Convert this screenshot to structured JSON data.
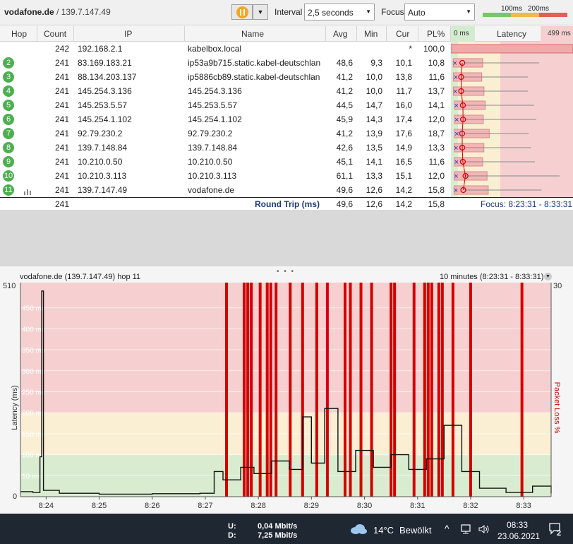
{
  "toolbar": {
    "host": "vodafone.de",
    "sep": " / ",
    "ip": "139.7.147.49",
    "interval_label": "Interval",
    "interval_value": "2,5 seconds",
    "focus_label": "Focus",
    "focus_value": "Auto",
    "scale_100": "100ms",
    "scale_200": "200ms"
  },
  "columns": {
    "hop": "Hop",
    "count": "Count",
    "ip": "IP",
    "name": "Name",
    "avg": "Avg",
    "min": "Min",
    "cur": "Cur",
    "pl": "PL%",
    "lat_min": "0 ms",
    "latency": "Latency",
    "lat_max": "499 ms"
  },
  "rows": [
    {
      "hop": "",
      "count": "242",
      "ip": "192.168.2.1",
      "name": "kabelbox.local",
      "avg": "",
      "min": "",
      "cur": "*",
      "pl": "100,0"
    },
    {
      "hop": "2",
      "count": "241",
      "ip": "83.169.183.21",
      "name": "ip53a9b715.static.kabel-deutschlan",
      "avg": "48,6",
      "min": "9,3",
      "cur": "10,1",
      "pl": "10,8"
    },
    {
      "hop": "3",
      "count": "241",
      "ip": "88.134.203.137",
      "name": "ip5886cb89.static.kabel-deutschlan",
      "avg": "41,2",
      "min": "10,0",
      "cur": "13,8",
      "pl": "11,6"
    },
    {
      "hop": "4",
      "count": "241",
      "ip": "145.254.3.136",
      "name": "145.254.3.136",
      "avg": "41,2",
      "min": "10,0",
      "cur": "11,7",
      "pl": "13,7"
    },
    {
      "hop": "5",
      "count": "241",
      "ip": "145.253.5.57",
      "name": "145.253.5.57",
      "avg": "44,5",
      "min": "14,7",
      "cur": "16,0",
      "pl": "14,1"
    },
    {
      "hop": "6",
      "count": "241",
      "ip": "145.254.1.102",
      "name": "145.254.1.102",
      "avg": "45,9",
      "min": "14,3",
      "cur": "17,4",
      "pl": "12,0"
    },
    {
      "hop": "7",
      "count": "241",
      "ip": "92.79.230.2",
      "name": "92.79.230.2",
      "avg": "41,2",
      "min": "13,9",
      "cur": "17,6",
      "pl": "18,7"
    },
    {
      "hop": "8",
      "count": "241",
      "ip": "139.7.148.84",
      "name": "139.7.148.84",
      "avg": "42,6",
      "min": "13,5",
      "cur": "14,9",
      "pl": "13,3"
    },
    {
      "hop": "9",
      "count": "241",
      "ip": "10.210.0.50",
      "name": "10.210.0.50",
      "avg": "45,1",
      "min": "14,1",
      "cur": "16,5",
      "pl": "11,6"
    },
    {
      "hop": "10",
      "count": "241",
      "ip": "10.210.3.113",
      "name": "10.210.3.113",
      "avg": "61,1",
      "min": "13,3",
      "cur": "15,1",
      "pl": "12,0"
    },
    {
      "hop": "11",
      "count": "241",
      "ip": "139.7.147.49",
      "name": "vodafone.de",
      "avg": "49,6",
      "min": "12,6",
      "cur": "14,2",
      "pl": "15,8"
    }
  ],
  "footer": {
    "count": "241",
    "label": "Round Trip (ms)",
    "avg": "49,6",
    "min": "12,6",
    "cur": "14,2",
    "pl": "15,8",
    "focus": "Focus: 8:23:31 - 8:33:31"
  },
  "graph": {
    "title": "vodafone.de (139.7.147.49) hop 11",
    "range": "10 minutes (8:23:31 - 8:33:31)",
    "y_max": "510",
    "y_zero": "0",
    "right_max": "30",
    "y_axis_label": "Latency (ms)",
    "right_axis_label": "Packet Loss %",
    "y_ticks": [
      "450 ms",
      "400 ms",
      "350 ms",
      "300 ms",
      "250 ms",
      "200 ms",
      "150 ms",
      "100 ms",
      "50 ms"
    ],
    "x_ticks": [
      "8:24",
      "8:25",
      "8:26",
      "8:27",
      "8:28",
      "8:29",
      "8:30",
      "8:31",
      "8:32",
      "8:33"
    ]
  },
  "chart_data": {
    "type": "line",
    "title": "vodafone.de (139.7.147.49) hop 11",
    "xlabel": "",
    "ylabel": "Latency (ms)",
    "y2label": "Packet Loss %",
    "ylim": [
      0,
      510
    ],
    "y2lim": [
      0,
      30
    ],
    "xlim": [
      "8:23:31",
      "8:33:31"
    ],
    "x_ticks": [
      "8:24",
      "8:25",
      "8:26",
      "8:27",
      "8:28",
      "8:29",
      "8:30",
      "8:31",
      "8:32",
      "8:33"
    ],
    "latency_series": [
      [
        "8:23:31",
        12
      ],
      [
        "8:23:45",
        10
      ],
      [
        "8:23:53",
        95
      ],
      [
        "8:23:55",
        490
      ],
      [
        "8:23:57",
        15
      ],
      [
        "8:24:15",
        8
      ],
      [
        "8:25:00",
        6
      ],
      [
        "8:26:00",
        7
      ],
      [
        "8:26:54",
        8
      ],
      [
        "8:27:10",
        60
      ],
      [
        "8:27:20",
        40
      ],
      [
        "8:27:40",
        70
      ],
      [
        "8:27:55",
        55
      ],
      [
        "8:28:15",
        85
      ],
      [
        "8:28:35",
        65
      ],
      [
        "8:28:50",
        190
      ],
      [
        "8:29:00",
        80
      ],
      [
        "8:29:15",
        210
      ],
      [
        "8:29:30",
        60
      ],
      [
        "8:29:50",
        110
      ],
      [
        "8:30:10",
        70
      ],
      [
        "8:30:30",
        100
      ],
      [
        "8:30:50",
        65
      ],
      [
        "8:31:10",
        90
      ],
      [
        "8:31:30",
        170
      ],
      [
        "8:31:50",
        60
      ],
      [
        "8:32:10",
        20
      ],
      [
        "8:32:40",
        10
      ],
      [
        "8:33:10",
        25
      ],
      [
        "8:33:31",
        8
      ]
    ],
    "packet_loss_times": [
      "8:27:24",
      "8:27:44",
      "8:27:48",
      "8:27:52",
      "8:28:02",
      "8:28:10",
      "8:28:14",
      "8:28:20",
      "8:28:36",
      "8:28:50",
      "8:29:06",
      "8:29:18",
      "8:29:38",
      "8:29:44",
      "8:29:56",
      "8:30:08",
      "8:30:30",
      "8:30:34",
      "8:30:56",
      "8:31:08",
      "8:31:12",
      "8:31:16",
      "8:31:24",
      "8:31:28",
      "8:31:40",
      "8:32:00",
      "8:32:58"
    ],
    "bands": [
      {
        "from": 0,
        "to": 100,
        "color": "#d9ecd0"
      },
      {
        "from": 100,
        "to": 200,
        "color": "#fbefd3"
      },
      {
        "from": 200,
        "to": 510,
        "color": "#f6d0d0"
      }
    ]
  },
  "taskbar": {
    "up_label": "U:",
    "up_value": "0,04 Mbit/s",
    "down_label": "D:",
    "down_value": "7,25 Mbit/s",
    "temp": "14°C",
    "weather": "Bewölkt",
    "time": "08:33",
    "date": "23.06.2021",
    "notify": "2"
  },
  "colors": {
    "green": "#4caf50",
    "loss": "#d40000",
    "orange": "#f5a623"
  }
}
